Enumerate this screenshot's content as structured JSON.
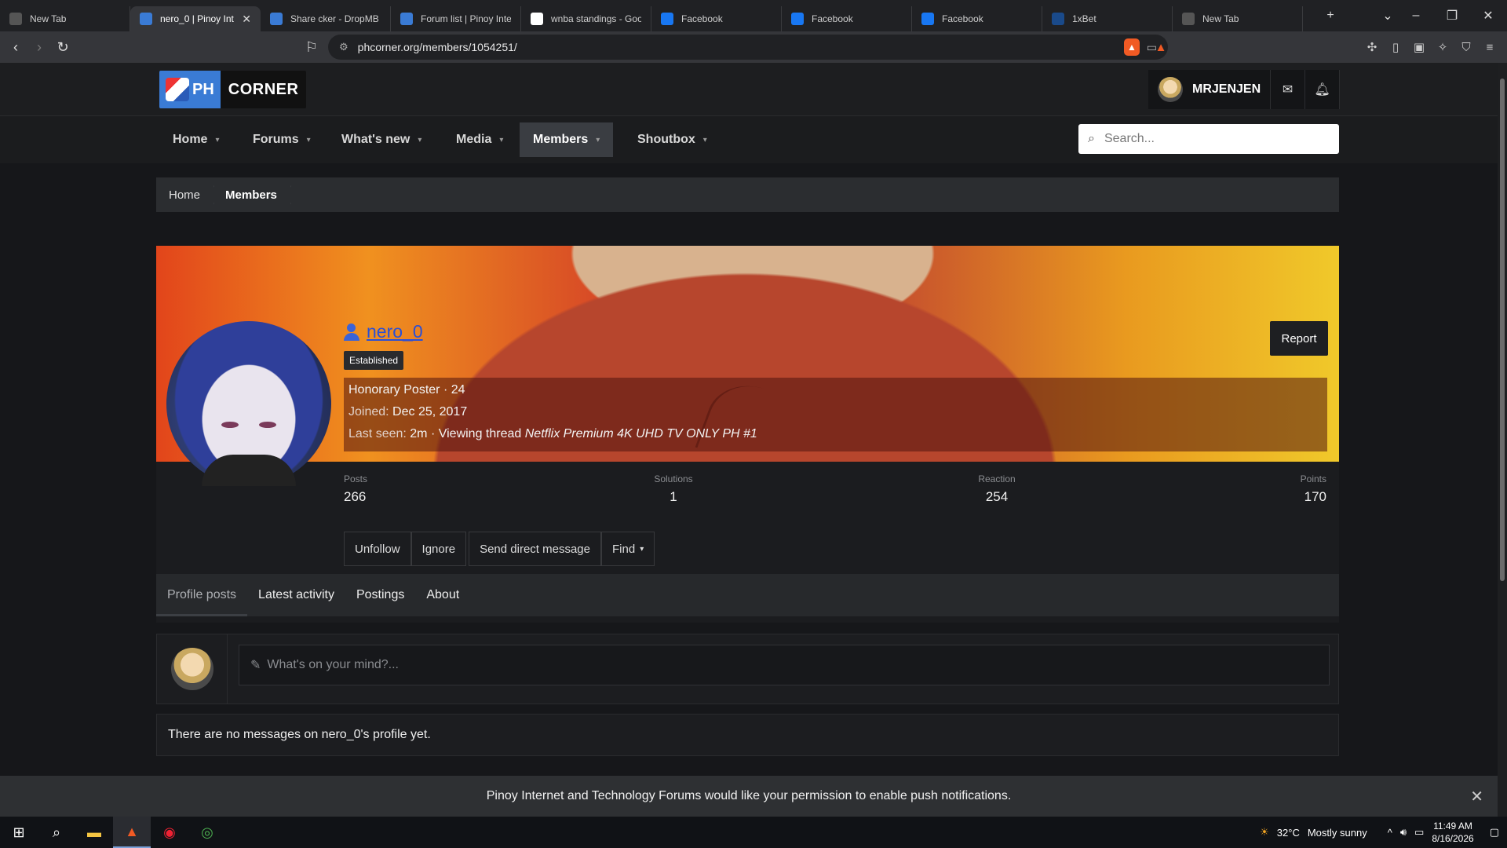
{
  "browser": {
    "tabs": [
      {
        "label": "New Tab",
        "icon": "brave-shield-icon",
        "color": "#555"
      },
      {
        "label": "nero_0 | Pinoy Inte",
        "icon": "phcorner-icon",
        "color": "#3a7bd5",
        "active": true
      },
      {
        "label": "Share cker - DropMB",
        "icon": "phcorner-icon",
        "color": "#3a7bd5"
      },
      {
        "label": "Forum list | Pinoy Inte",
        "icon": "phcorner-icon",
        "color": "#3a7bd5"
      },
      {
        "label": "wnba standings - Goo",
        "icon": "google-icon",
        "color": "#fff"
      },
      {
        "label": "Facebook",
        "icon": "facebook-icon",
        "color": "#1877f2"
      },
      {
        "label": "Facebook",
        "icon": "facebook-icon",
        "color": "#1877f2"
      },
      {
        "label": "Facebook",
        "icon": "facebook-icon",
        "color": "#1877f2"
      },
      {
        "label": "1xBet",
        "icon": "1xbet-icon",
        "color": "#1a4a8a"
      },
      {
        "label": "New Tab",
        "icon": "brave-shield-icon",
        "color": "#555"
      }
    ],
    "url": "phcorner.org/members/1054251/"
  },
  "header": {
    "logo_ph": "PH",
    "logo_corner": "CORNER",
    "username": "MRJENJEN"
  },
  "nav": {
    "items": [
      {
        "label": "Home"
      },
      {
        "label": "Forums"
      },
      {
        "label": "What's new"
      },
      {
        "label": "Media"
      },
      {
        "label": "Members",
        "selected": true
      },
      {
        "label": "Shoutbox"
      }
    ],
    "search_placeholder": "Search..."
  },
  "breadcrumb": [
    "Home",
    "Members"
  ],
  "profile": {
    "name": "nero_0",
    "badge": "Established",
    "title_line": "Honorary Poster · 24",
    "joined_label": "Joined:",
    "joined_value": "Dec 25, 2017",
    "lastseen_label": "Last seen:",
    "lastseen_value": "2m · Viewing thread",
    "lastseen_thread": "Netflix Premium 4K UHD TV ONLY PH #1",
    "report": "Report",
    "stats": [
      {
        "label": "Posts",
        "value": "266"
      },
      {
        "label": "Solutions",
        "value": "1"
      },
      {
        "label": "Reaction",
        "value": "254"
      },
      {
        "label": "Points",
        "value": "170"
      }
    ],
    "actions": [
      "Unfollow",
      "Ignore",
      "Send direct message",
      "Find"
    ]
  },
  "profile_tabs": [
    "Profile posts",
    "Latest activity",
    "Postings",
    "About"
  ],
  "composer_placeholder": "What's on your mind?...",
  "empty_message": "There are no messages on nero_0's profile yet.",
  "notification": "Pinoy Internet and Technology Forums would like your permission to enable push notifications.",
  "taskbar": {
    "weather_temp": "32°C",
    "weather_text": "Mostly sunny",
    "time": "11:49 AM",
    "date": "8/16/2026"
  }
}
